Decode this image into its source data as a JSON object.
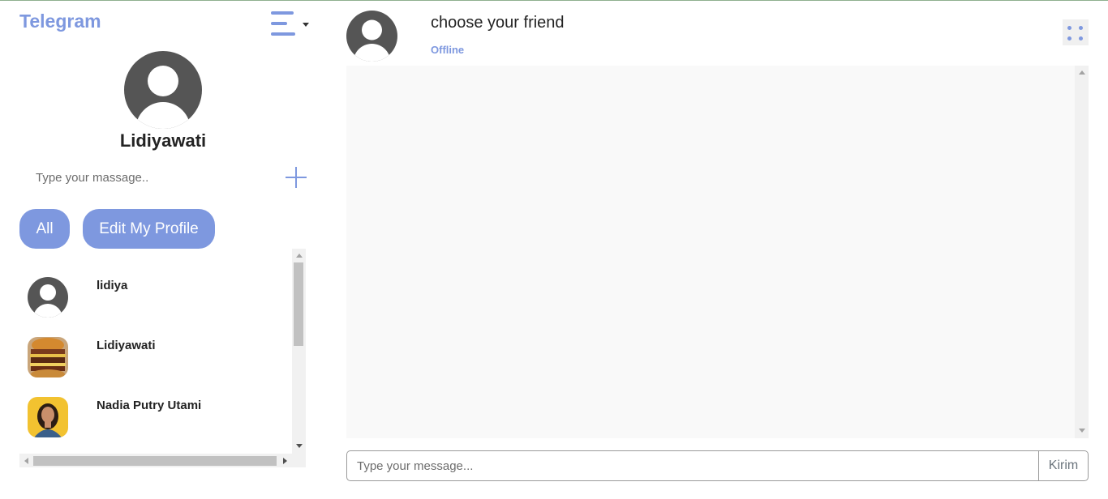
{
  "app": {
    "brand": "Telegram"
  },
  "sidebar": {
    "profile_name": "Lidiyawati",
    "search_placeholder": "Type your massage..",
    "tabs": {
      "all_label": "All",
      "edit_profile_label": "Edit My Profile"
    },
    "contacts": [
      {
        "name": "lidiya",
        "avatar": "default-user-avatar"
      },
      {
        "name": "Lidiyawati",
        "avatar": "burger-photo-avatar"
      },
      {
        "name": "Nadia Putry Utami",
        "avatar": "woman-photo-avatar"
      }
    ]
  },
  "chat": {
    "title": "choose your friend",
    "status": "Offline",
    "composer_placeholder": "Type your message...",
    "send_label": "Kirim"
  },
  "colors": {
    "accent": "#7e98df",
    "avatar_gray": "#555555",
    "panel_bg": "#f9f9f9"
  }
}
